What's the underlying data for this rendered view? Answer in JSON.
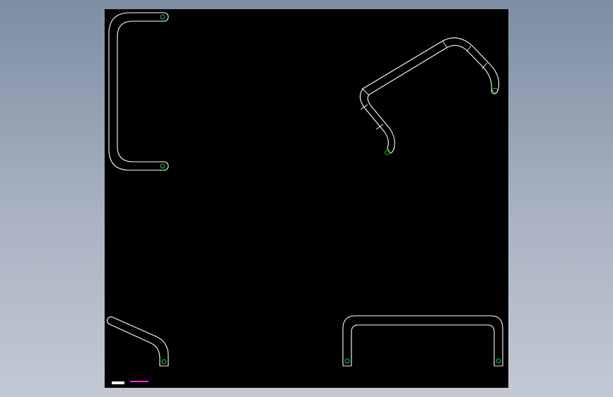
{
  "drawing": {
    "background_color": "#000000",
    "line_color": "#ffffff",
    "end_marker_color": "#2fbf3a",
    "label_color": "#ff2bff"
  },
  "title_block": {
    "left_text": "",
    "right_text": ""
  },
  "views": [
    {
      "name": "top-left-u-tube-view"
    },
    {
      "name": "top-right-bent-tube-view"
    },
    {
      "name": "bottom-left-bent-tube-view"
    },
    {
      "name": "bottom-right-u-tube-view"
    }
  ]
}
